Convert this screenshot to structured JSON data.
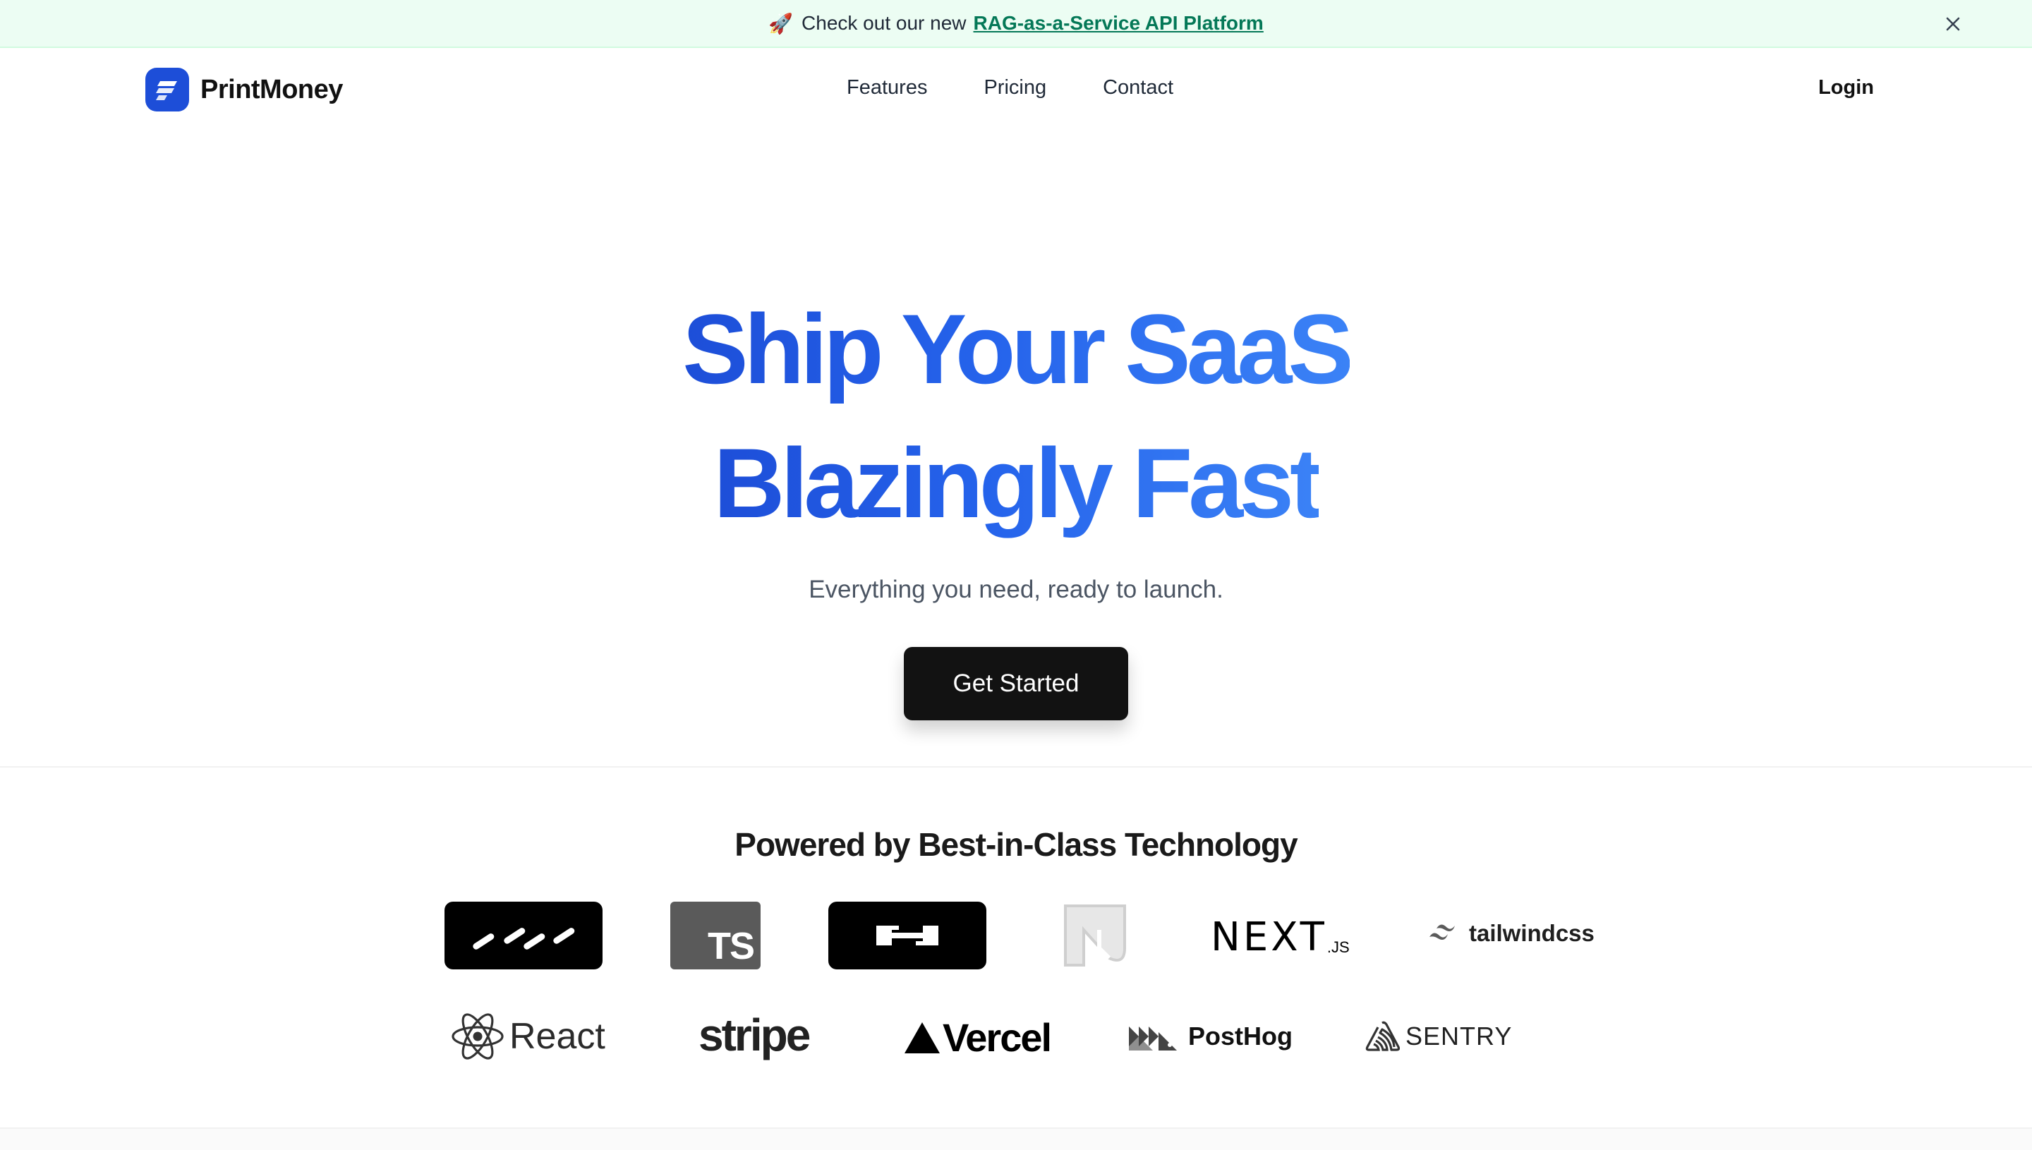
{
  "announcement": {
    "prefix": "Check out our new",
    "link_text": "RAG-as-a-Service API Platform",
    "icon": "rocket-icon"
  },
  "header": {
    "brand_name": "PrintMoney",
    "nav": [
      "Features",
      "Pricing",
      "Contact"
    ],
    "login_label": "Login"
  },
  "hero": {
    "title_line1": "Ship Your SaaS",
    "title_line2": "Blazingly Fast",
    "subtitle": "Everything you need, ready to launch.",
    "cta_label": "Get Started",
    "gradient_colors": [
      "#1d4ed8",
      "#3b82f6"
    ]
  },
  "tech": {
    "heading": "Powered by Best-in-Class Technology",
    "logos_row1": [
      {
        "icon": "drizzle-logo-icon"
      },
      {
        "icon": "typescript-logo-icon",
        "text": "TS"
      },
      {
        "icon": "hono-logo-icon"
      },
      {
        "icon": "neon-logo-icon"
      },
      {
        "icon": "nextjs-logo-icon",
        "text": "NEXT",
        "suffix": ".JS"
      },
      {
        "icon": "tailwindcss-logo-icon",
        "text": "tailwindcss"
      }
    ],
    "logos_row2": [
      {
        "icon": "react-logo-icon",
        "text": "React"
      },
      {
        "icon": "stripe-logo-icon",
        "text": "stripe"
      },
      {
        "icon": "vercel-logo-icon",
        "text": "Vercel"
      },
      {
        "icon": "posthog-logo-icon",
        "text": "PostHog"
      },
      {
        "icon": "sentry-logo-icon",
        "text": "SENTRY"
      }
    ]
  }
}
